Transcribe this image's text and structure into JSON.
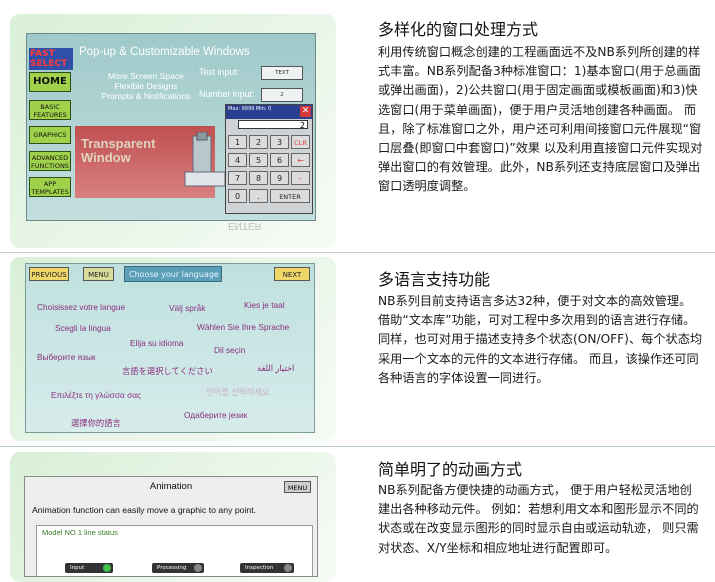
{
  "sections": [
    {
      "heading": "多样化的窗口处理方式",
      "body": "利用传统窗口概念创建的工程画面远不及NB系列所创建的样式丰富。NB系列配备3种标准窗口：1)基本窗口(用于总画面或弹出画面)，2)公共窗口(用于固定画面或模板画面)和3)快选窗口(用于菜单画面)，便于用户灵活地创建各种画面。 而且，除了标准窗口之外，用户还可利用间接窗口元件展现“窗口层叠(即窗口中套窗口)”效果 以及利用直接窗口元件实现对弹出窗口的有效管理。此外，NB系列还支持底层窗口及弹出窗口透明度调整。"
    },
    {
      "heading": "多语言支持功能",
      "body": "NB系列目前支持语言多达32种，便于对文本的高效管理。 借助“文本库”功能，可对工程中多次用到的语言进行存储。 同样，也可对用于描述支持多个状态(ON/OFF)、每个状态均采用一个文本的元件的文本进行存储。 而且，该操作还可同各种语言的字体设置一同进行。"
    },
    {
      "heading": "简单明了的动画方式",
      "body": "NB系列配备方便快捷的动画方式， 便于用户轻松灵活地创建出各种移动元件。 例如：若想利用文本和图形显示不同的状态或在改变显示图形的同时显示自由或运动轨迹， 则只需对状态、X/Y坐标和相应地址进行配置即可。"
    }
  ],
  "screen1": {
    "fast_select": "FAST SELECT",
    "side_buttons": [
      "HOME",
      "BASIC FEATURES",
      "GRAPHICS",
      "ADVANCED FUNCTIONS",
      "APP TEMPLATES"
    ],
    "title": "Pop-up & Customizable Windows",
    "features": [
      "More Screen Space",
      "Flexible Designs",
      "Prompts & Notifications"
    ],
    "text_input_label": "Text input:",
    "text_input_value": "TEXT",
    "number_input_label": "Number input:",
    "number_input_value": "2",
    "transparent_label": "Transparent Window",
    "keypad": {
      "header": "Max: 9999 Min: 0",
      "close": "✕",
      "display": "2",
      "keys": [
        [
          "1",
          "2",
          "3",
          "CLR"
        ],
        [
          "4",
          "5",
          "6",
          "←"
        ],
        [
          "7",
          "8",
          "9",
          "-"
        ],
        [
          "0",
          ".",
          "ENTER"
        ]
      ]
    },
    "reflection": "ENTER"
  },
  "screen2": {
    "previous": "PREVIOUS",
    "menu": "MENU",
    "choose": "Choose your language",
    "next": "NEXT",
    "languages": [
      "Choisissez votre langue",
      "Välj språk",
      "Kies je taal",
      "Scegli la lingua",
      "Wählen Sie Ihre Sprache",
      "Elija su idioma",
      "Выберите язык",
      "Dil seçin",
      "言語を選択してください",
      "اختيار اللغة",
      "Επιλέξτε τη γλώσσα σας",
      "언어를 선택하세요",
      "Одаберите језик",
      "選擇你的語言"
    ]
  },
  "screen3": {
    "title": "Animation",
    "menu": "MENU",
    "description": "Animation function can easily move a graphic to any point.",
    "status_title": "Model NO.1 line status",
    "states": [
      "Input",
      "Processing",
      "Inspection"
    ]
  }
}
